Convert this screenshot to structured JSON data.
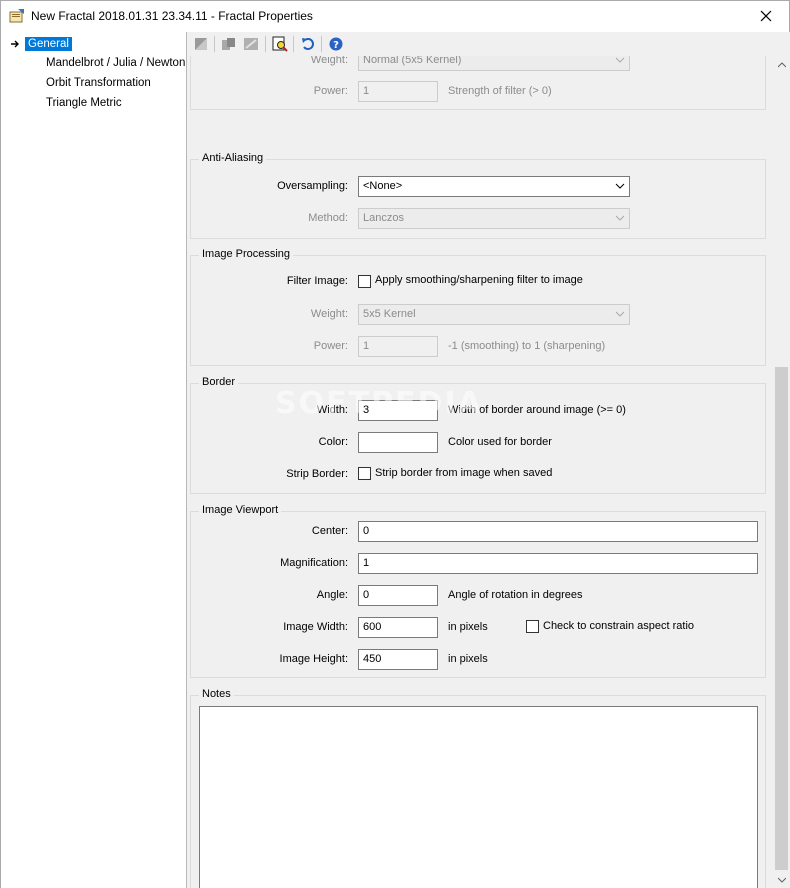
{
  "window": {
    "title": "New Fractal 2018.01.31 23.34.11 - Fractal Properties"
  },
  "tree": {
    "items": [
      {
        "label": "General",
        "selected": true
      },
      {
        "label": "Mandelbrot / Julia / Newton"
      },
      {
        "label": "Orbit Transformation"
      },
      {
        "label": "Triangle Metric"
      }
    ]
  },
  "toolbar": {
    "icons": [
      "save-icon",
      "copy-settings-icon",
      "paste-settings-icon",
      "find-icon",
      "undo-icon",
      "help-icon"
    ]
  },
  "partial_group": {
    "weight_label": "Weight:",
    "weight_value": "Normal (5x5 Kernel)",
    "power_label": "Power:",
    "power_value": "1",
    "power_hint": "Strength of filter (> 0)"
  },
  "anti_aliasing": {
    "title": "Anti-Aliasing",
    "oversampling_label": "Oversampling:",
    "oversampling_value": "<None>",
    "method_label": "Method:",
    "method_value": "Lanczos"
  },
  "image_processing": {
    "title": "Image Processing",
    "filter_label": "Filter Image:",
    "filter_checkbox_label": "Apply smoothing/sharpening filter to image",
    "weight_label": "Weight:",
    "weight_value": "5x5 Kernel",
    "power_label": "Power:",
    "power_value": "1",
    "power_hint": "-1 (smoothing) to 1 (sharpening)"
  },
  "border": {
    "title": "Border",
    "width_label": "Width:",
    "width_value": "3",
    "width_hint": "Width of border around image (>= 0)",
    "color_label": "Color:",
    "color_value": "",
    "color_hint": "Color used for border",
    "strip_label": "Strip Border:",
    "strip_checkbox_label": "Strip border from image when saved"
  },
  "viewport": {
    "title": "Image Viewport",
    "center_label": "Center:",
    "center_value": "0",
    "magnification_label": "Magnification:",
    "magnification_value": "1",
    "angle_label": "Angle:",
    "angle_value": "0",
    "angle_hint": "Angle of rotation in degrees",
    "width_label": "Image Width:",
    "width_value": "600",
    "width_hint": "in pixels",
    "constrain_label": "Check to constrain aspect ratio",
    "height_label": "Image Height:",
    "height_value": "450",
    "height_hint": "in pixels"
  },
  "notes": {
    "title": "Notes",
    "value": ""
  },
  "watermark": "SOFTPEDIA"
}
